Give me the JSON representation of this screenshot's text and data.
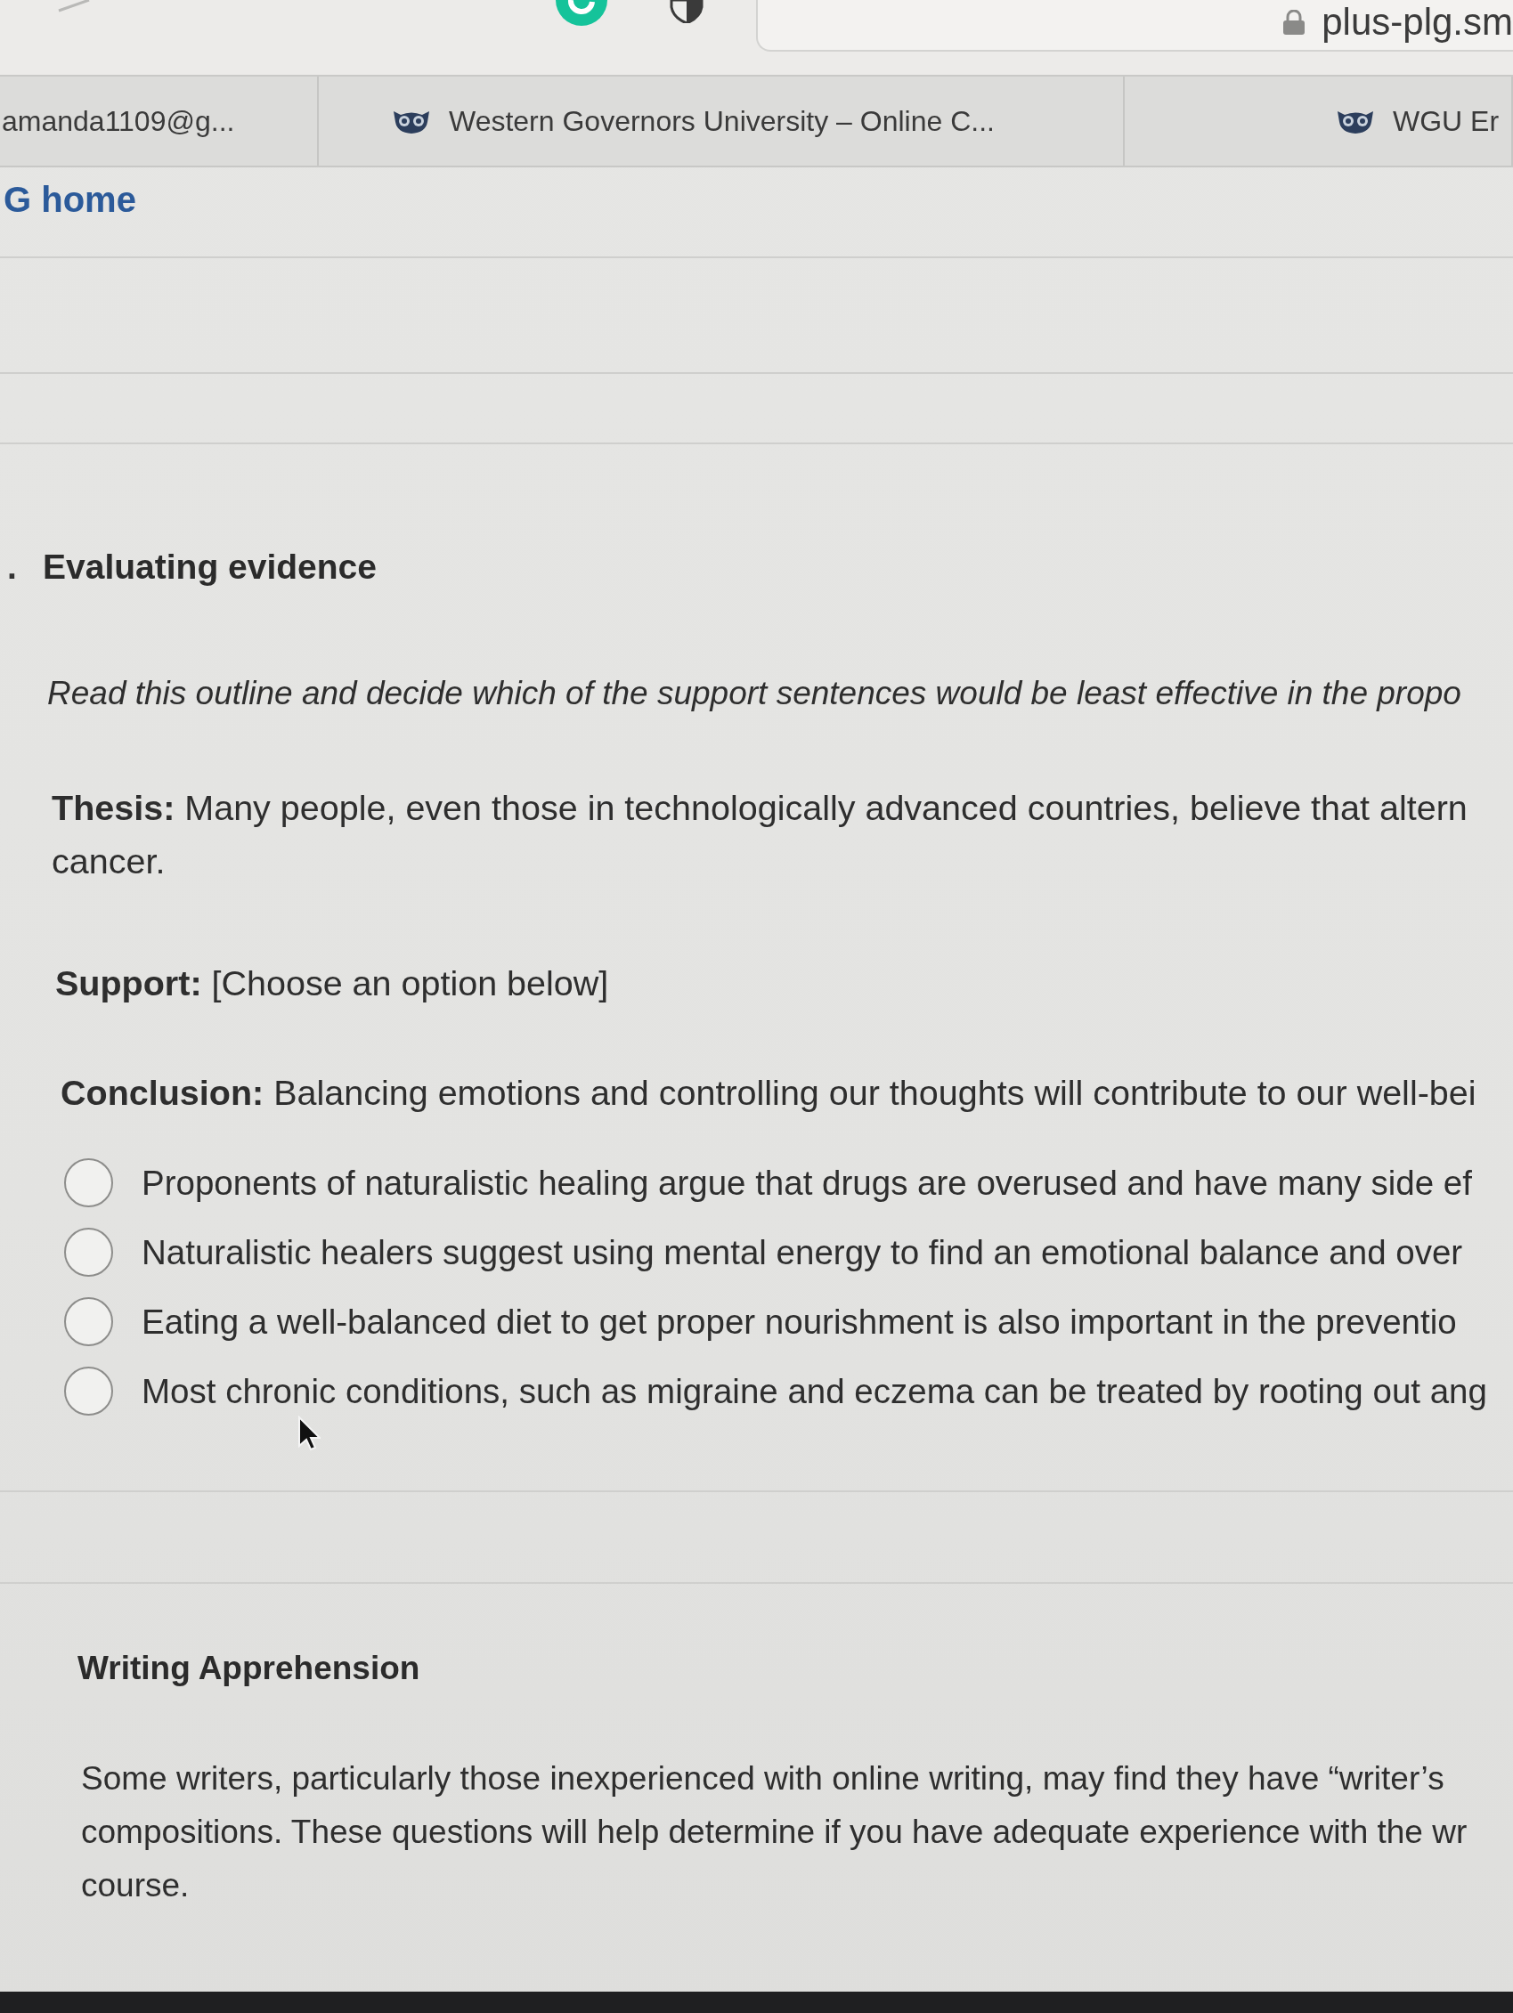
{
  "browser": {
    "address": "plus-plg.sm"
  },
  "tabs": [
    {
      "label": "amanda1109@g...",
      "selected": false,
      "favicon": false
    },
    {
      "label": "Western Governors University – Online C...",
      "selected": false,
      "favicon": true
    },
    {
      "label": "WGU Er",
      "selected": false,
      "favicon": true
    }
  ],
  "home_link": "G home",
  "question": {
    "number": ".",
    "title": "Evaluating evidence",
    "instruction": "Read this outline and decide which of the support sentences would be least effective in the propo",
    "outline": [
      {
        "lines": [
          "**Thesis:** Many people, even those in technologically advanced countries, believe that altern",
          "cancer."
        ]
      },
      {
        "lines": [
          "**Support:** [Choose an option below]"
        ]
      },
      {
        "lines": [
          "**Conclusion:** Balancing emotions and controlling our thoughts will contribute to our well-bei"
        ]
      }
    ],
    "options": [
      {
        "text": "Proponents of naturalistic healing argue that drugs are overused and have many side ef",
        "selected": false,
        "pointer": false
      },
      {
        "text": "Naturalistic healers suggest using mental energy to find an emotional balance and over",
        "selected": false,
        "pointer": false
      },
      {
        "text": "Eating a well-balanced diet to get proper nourishment is also important in the preventio",
        "selected": false,
        "pointer": false
      },
      {
        "text": "Most chronic conditions, such as migraine and eczema can be treated by rooting out ang",
        "selected": false,
        "pointer": true
      }
    ]
  },
  "section": {
    "title": "Writing Apprehension",
    "lines": [
      "Some writers, particularly those inexperienced with online writing, may find they have “writer’s",
      "compositions. These questions will help determine if you have adequate experience with the wr",
      "course."
    ]
  }
}
